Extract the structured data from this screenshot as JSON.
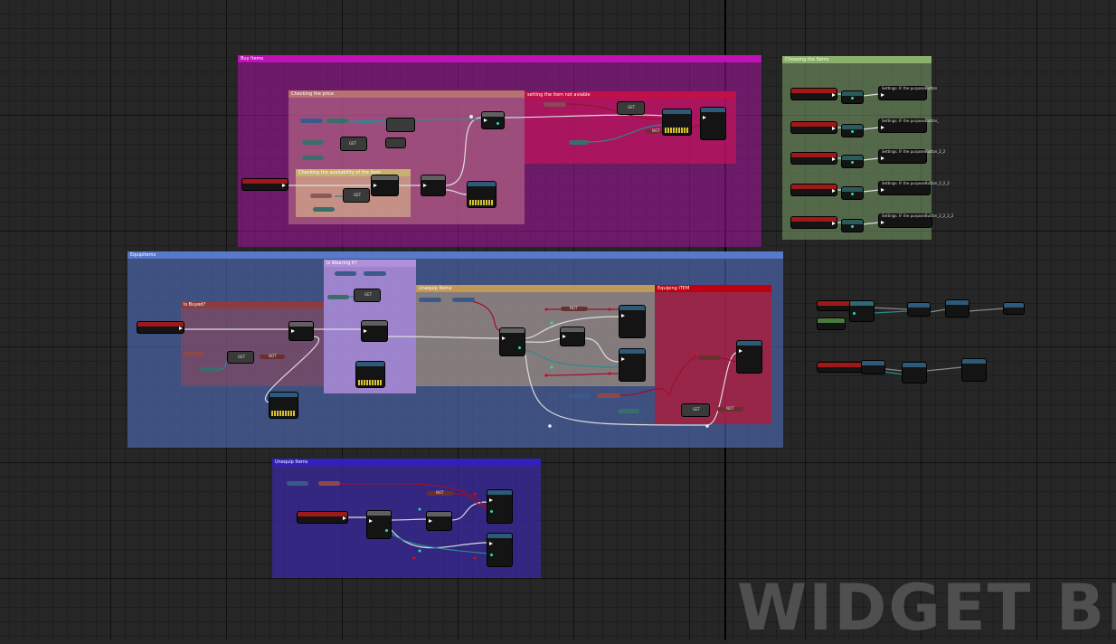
{
  "editor": {
    "watermark": "WIDGET BLUE",
    "accent_colors": {
      "exec": "#ffffff",
      "bool": "#8c0000",
      "object": "#00a8f4",
      "int": "#1fe3af"
    }
  },
  "comments": {
    "buy_items": {
      "label": "Buy Items",
      "color": "#c010b8"
    },
    "checking_price": {
      "label": "Checking the price",
      "color": "#c08080"
    },
    "checking_avail": {
      "label": "Checking the availability of the item",
      "color": "#d8d080"
    },
    "setting_not_avail": {
      "label": "setting the item not aviable",
      "color": "#d01050"
    },
    "choosing_items": {
      "label": "Choosing the Items",
      "color": "#90c070"
    },
    "equip_items": {
      "label": "EquipItems",
      "color": "#5070c0"
    },
    "is_buyed": {
      "label": "Is Buyed?",
      "color": "#a04040"
    },
    "is_wearing": {
      "label": "Is Wearing It?",
      "color": "#c0a0e8"
    },
    "unequip_items_inner": {
      "label": "Unequip Items",
      "color": "#d8a060"
    },
    "equiping_item": {
      "label": "Equiping ITEM",
      "color": "#c00010"
    },
    "unequip_items": {
      "label": "Unequip Items",
      "color": "#3020c0"
    }
  },
  "nodes": {
    "get1": "GET",
    "get2": "GET",
    "get3": "GET",
    "get4": "GET",
    "get5": "GET",
    "get6": "GET",
    "not1": "NOT",
    "not2": "NOT",
    "not3": "NOT",
    "not4": "NOT",
    "not5": "NOT",
    "set_items": [
      "Settings: IF the purposeButton",
      "Settings: IF the purposeButton_",
      "Settings: IF the purposeButton_2_2",
      "Settings: IF the purposeButton_2_2_2",
      "Settings: IF the purposeButton_2_2_2_2"
    ]
  }
}
